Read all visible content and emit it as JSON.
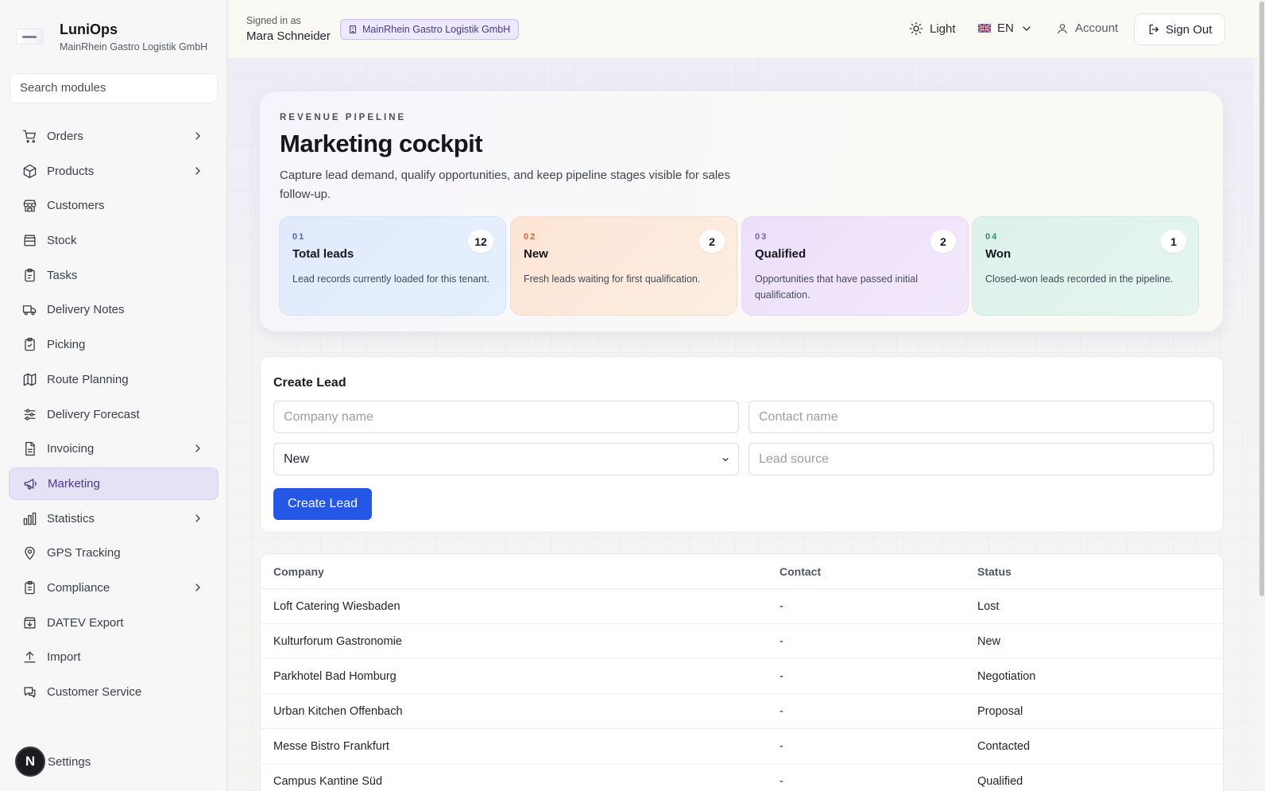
{
  "brand": {
    "name": "LuniOps",
    "tenant": "MainRhein Gastro Logistik GmbH"
  },
  "sidebar": {
    "search_placeholder": "Search modules",
    "items": [
      {
        "label": "Orders",
        "icon": "cart-icon",
        "has_children": true
      },
      {
        "label": "Products",
        "icon": "box-icon",
        "has_children": true
      },
      {
        "label": "Customers",
        "icon": "store-icon",
        "has_children": false
      },
      {
        "label": "Stock",
        "icon": "archive-icon",
        "has_children": false
      },
      {
        "label": "Tasks",
        "icon": "clipboard-icon",
        "has_children": false
      },
      {
        "label": "Delivery Notes",
        "icon": "truck-icon",
        "has_children": false
      },
      {
        "label": "Picking",
        "icon": "clipboard-check-icon",
        "has_children": false
      },
      {
        "label": "Route Planning",
        "icon": "map-icon",
        "has_children": false
      },
      {
        "label": "Delivery Forecast",
        "icon": "sliders-icon",
        "has_children": false
      },
      {
        "label": "Invoicing",
        "icon": "file-icon",
        "has_children": true
      },
      {
        "label": "Marketing",
        "icon": "megaphone-icon",
        "has_children": false,
        "active": true
      },
      {
        "label": "Statistics",
        "icon": "bar-chart-icon",
        "has_children": true
      },
      {
        "label": "GPS Tracking",
        "icon": "map-pin-icon",
        "has_children": false
      },
      {
        "label": "Compliance",
        "icon": "clipboard-list-icon",
        "has_children": true
      },
      {
        "label": "DATEV Export",
        "icon": "download-box-icon",
        "has_children": false
      },
      {
        "label": "Import",
        "icon": "upload-icon",
        "has_children": false
      },
      {
        "label": "Customer Service",
        "icon": "chat-icon",
        "has_children": false
      }
    ],
    "footer": {
      "avatar_letter": "N",
      "label": "Settings"
    }
  },
  "topbar": {
    "signed_in_label": "Signed in as",
    "user_name": "Mara Schneider",
    "tenant_badge": "MainRhein Gastro Logistik GmbH",
    "theme_label": "Light",
    "language": "EN",
    "account_label": "Account",
    "signout_label": "Sign Out"
  },
  "hero": {
    "eyebrow": "REVENUE PIPELINE",
    "title": "Marketing cockpit",
    "description": "Capture lead demand, qualify opportunities, and keep pipeline stages visible for sales follow-up.",
    "stats": [
      {
        "num": "01",
        "title": "Total leads",
        "count": "12",
        "desc": "Lead records currently loaded for this tenant."
      },
      {
        "num": "02",
        "title": "New",
        "count": "2",
        "desc": "Fresh leads waiting for first qualification."
      },
      {
        "num": "03",
        "title": "Qualified",
        "count": "2",
        "desc": "Opportunities that have passed initial qualification."
      },
      {
        "num": "04",
        "title": "Won",
        "count": "1",
        "desc": "Closed-won leads recorded in the pipeline."
      }
    ]
  },
  "create_lead": {
    "title": "Create Lead",
    "company_placeholder": "Company name",
    "contact_placeholder": "Contact name",
    "status_value": "New",
    "source_placeholder": "Lead source",
    "button_label": "Create Lead"
  },
  "leads_table": {
    "columns": [
      "Company",
      "Contact",
      "Status"
    ],
    "rows": [
      [
        "Loft Catering Wiesbaden",
        "-",
        "Lost"
      ],
      [
        "Kulturforum Gastronomie",
        "-",
        "New"
      ],
      [
        "Parkhotel Bad Homburg",
        "-",
        "Negotiation"
      ],
      [
        "Urban Kitchen Offenbach",
        "-",
        "Proposal"
      ],
      [
        "Messe Bistro Frankfurt",
        "-",
        "Contacted"
      ],
      [
        "Campus Kantine Süd",
        "-",
        "Qualified"
      ]
    ]
  },
  "colors": {
    "accent": "#2457e6",
    "active_nav_bg": "#e6e1f5",
    "active_nav_text": "#4b3a8c"
  }
}
